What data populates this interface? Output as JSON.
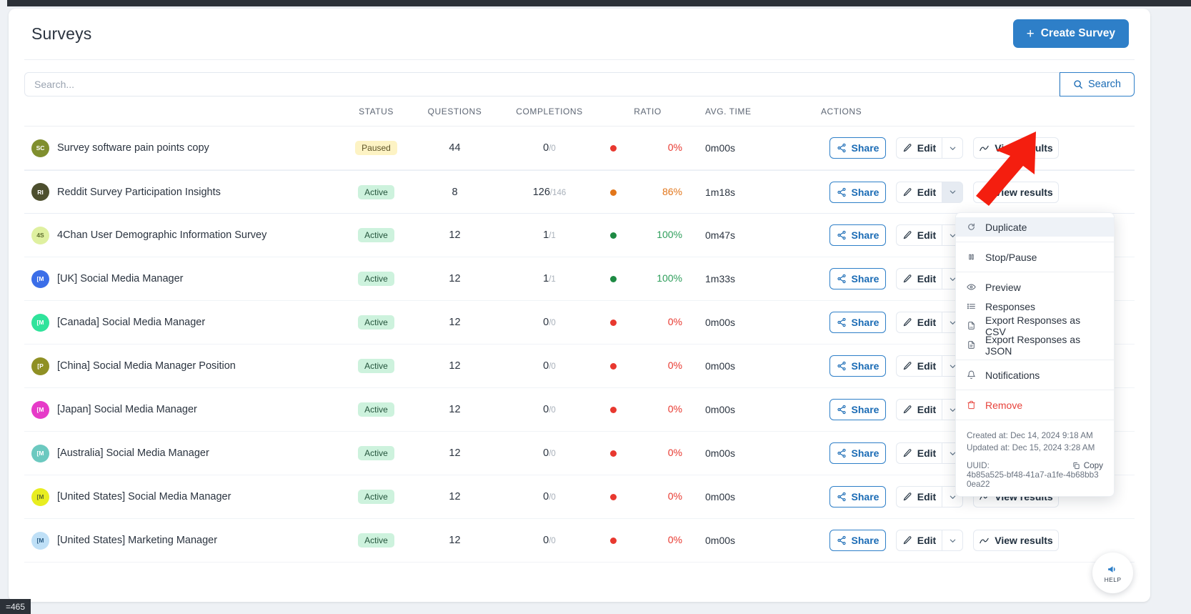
{
  "header": {
    "title": "Surveys",
    "create_button": "Create Survey",
    "create_icon": "plus-icon"
  },
  "search": {
    "placeholder": "Search...",
    "value": "",
    "button_label": "Search",
    "button_icon": "search-icon"
  },
  "table": {
    "columns": [
      "",
      "STATUS",
      "QUESTIONS",
      "COMPLETIONS",
      "RATIO",
      "AVG. TIME",
      "ACTIONS"
    ],
    "rows": [
      {
        "avatar": "SC",
        "avatar_color": "#808f2e",
        "name": "Survey software pain points copy",
        "status": "Paused",
        "status_kind": "paused",
        "questions": "44",
        "completions_main": "0",
        "completions_sub": "/0",
        "ratio": "0%",
        "ratio_color": "#e8382f",
        "dot_color": "#e8382f",
        "avg_time": "0m00s"
      },
      {
        "avatar": "RI",
        "avatar_color": "#4d4f2e",
        "name": "Reddit Survey Participation Insights",
        "status": "Active",
        "status_kind": "active",
        "questions": "8",
        "completions_main": "126",
        "completions_sub": "/146",
        "ratio": "86%",
        "ratio_color": "#e2761b",
        "dot_color": "#e2761b",
        "avg_time": "1m18s"
      },
      {
        "avatar": "4S",
        "avatar_color": "#dff0a0",
        "avatar_text_color": "#5c6b2c",
        "name": "4Chan User Demographic Information Survey",
        "status": "Active",
        "status_kind": "active",
        "questions": "12",
        "completions_main": "1",
        "completions_sub": "/1",
        "ratio": "100%",
        "ratio_color": "#2e9e5b",
        "dot_color": "#1d8a43",
        "avg_time": "0m47s"
      },
      {
        "avatar": "[M",
        "avatar_color": "#3b6ee8",
        "name": "[UK] Social Media Manager",
        "status": "Active",
        "status_kind": "active",
        "questions": "12",
        "completions_main": "1",
        "completions_sub": "/1",
        "ratio": "100%",
        "ratio_color": "#2e9e5b",
        "dot_color": "#1d8a43",
        "avg_time": "1m33s"
      },
      {
        "avatar": "[M",
        "avatar_color": "#2fe39b",
        "name": "[Canada] Social Media Manager",
        "status": "Active",
        "status_kind": "active",
        "questions": "12",
        "completions_main": "0",
        "completions_sub": "/0",
        "ratio": "0%",
        "ratio_color": "#e8382f",
        "dot_color": "#e8382f",
        "avg_time": "0m00s"
      },
      {
        "avatar": "[P",
        "avatar_color": "#8f9024",
        "name": "[China] Social Media Manager Position",
        "status": "Active",
        "status_kind": "active",
        "questions": "12",
        "completions_main": "0",
        "completions_sub": "/0",
        "ratio": "0%",
        "ratio_color": "#e8382f",
        "dot_color": "#e8382f",
        "avg_time": "0m00s"
      },
      {
        "avatar": "[M",
        "avatar_color": "#e63bc8",
        "name": "[Japan] Social Media Manager",
        "status": "Active",
        "status_kind": "active",
        "questions": "12",
        "completions_main": "0",
        "completions_sub": "/0",
        "ratio": "0%",
        "ratio_color": "#e8382f",
        "dot_color": "#e8382f",
        "avg_time": "0m00s"
      },
      {
        "avatar": "[M",
        "avatar_color": "#6cc9c0",
        "name": "[Australia] Social Media Manager",
        "status": "Active",
        "status_kind": "active",
        "questions": "12",
        "completions_main": "0",
        "completions_sub": "/0",
        "ratio": "0%",
        "ratio_color": "#e8382f",
        "dot_color": "#e8382f",
        "avg_time": "0m00s"
      },
      {
        "avatar": "[M",
        "avatar_color": "#e8ed20",
        "avatar_text_color": "#5c6b2c",
        "name": "[United States] Social Media Manager",
        "status": "Active",
        "status_kind": "active",
        "questions": "12",
        "completions_main": "0",
        "completions_sub": "/0",
        "ratio": "0%",
        "ratio_color": "#e8382f",
        "dot_color": "#e8382f",
        "avg_time": "0m00s"
      },
      {
        "avatar": "[M",
        "avatar_color": "#bfe0f7",
        "avatar_text_color": "#2b5d85",
        "name": "[United States] Marketing Manager",
        "status": "Active",
        "status_kind": "active",
        "questions": "12",
        "completions_main": "0",
        "completions_sub": "/0",
        "ratio": "0%",
        "ratio_color": "#e8382f",
        "dot_color": "#e8382f",
        "avg_time": "0m00s"
      }
    ]
  },
  "actions": {
    "share": "Share",
    "edit": "Edit",
    "view_results": "View results",
    "share_icon": "share-icon",
    "edit_icon": "pencil-icon",
    "caret_icon": "chevron-down-icon",
    "view_icon": "chart-icon"
  },
  "dropdown": {
    "items": [
      {
        "label": "Duplicate",
        "icon": "duplicate-icon",
        "hover": true,
        "danger": false
      },
      {
        "label": "Stop/Pause",
        "icon": "pause-icon",
        "hover": false,
        "danger": false
      },
      {
        "label": "Preview",
        "icon": "eye-icon",
        "hover": false,
        "danger": false
      },
      {
        "label": "Responses",
        "icon": "list-icon",
        "hover": false,
        "danger": false
      },
      {
        "label": "Export Responses as CSV",
        "icon": "file-csv-icon",
        "hover": false,
        "danger": false
      },
      {
        "label": "Export Responses as JSON",
        "icon": "file-json-icon",
        "hover": false,
        "danger": false
      },
      {
        "label": "Notifications",
        "icon": "bell-icon",
        "hover": false,
        "danger": false
      },
      {
        "label": "Remove",
        "icon": "trash-icon",
        "hover": false,
        "danger": true
      }
    ],
    "created_at": "Created at: Dec 14, 2024 9:18 AM",
    "updated_at": "Updated at: Dec 15, 2024 3:28 AM",
    "uuid_label": "UUID:",
    "uuid_value": "4b85a525-bf48-41a7-a1fe-4b68bb30ea22",
    "copy_label": "Copy",
    "copy_icon": "copy-icon"
  },
  "help": {
    "label": "HELP",
    "icon": "help-megaphone-icon"
  },
  "statusbar": {
    "text": "=465"
  },
  "colors": {
    "accent": "#2e7fc8",
    "danger": "#e7423b",
    "success": "#1d8a43",
    "warning": "#e2761b"
  }
}
